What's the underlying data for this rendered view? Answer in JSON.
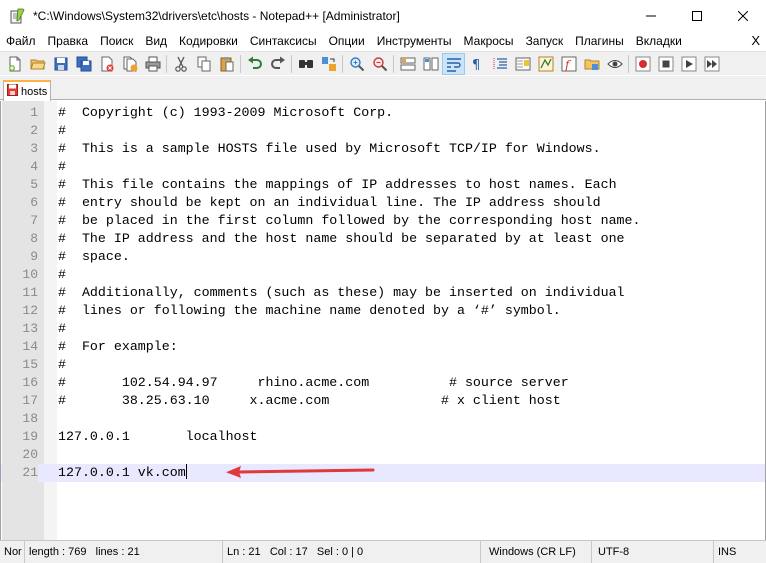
{
  "window": {
    "title": "*C:\\Windows\\System32\\drivers\\etc\\hosts - Notepad++ [Administrator]"
  },
  "menu": {
    "items": [
      "Файл",
      "Правка",
      "Поиск",
      "Вид",
      "Кодировки",
      "Синтаксисы",
      "Опции",
      "Инструменты",
      "Макросы",
      "Запуск",
      "Плагины",
      "Вкладки"
    ],
    "close": "X"
  },
  "toolbar": {
    "icons": [
      "new-file-icon",
      "open-file-icon",
      "save-icon",
      "save-all-icon",
      "close-icon",
      "close-all-icon",
      "print-icon",
      "cut-icon",
      "copy-icon",
      "paste-icon",
      "undo-icon",
      "redo-icon",
      "find-icon",
      "replace-icon",
      "zoom-in-icon",
      "zoom-out-icon",
      "sync-vertical-icon",
      "sync-horizontal-icon",
      "word-wrap-icon",
      "show-all-chars-icon",
      "indent-guide-icon",
      "doc-map-icon",
      "function-list-icon",
      "folder-workspace-icon",
      "monitor-icon",
      "record-macro-icon",
      "stop-macro-icon",
      "play-macro-icon"
    ]
  },
  "tab": {
    "label": "hosts"
  },
  "editor": {
    "lines": [
      {
        "n": "1",
        "text": "#  Copyright (c) 1993-2009 Microsoft Corp."
      },
      {
        "n": "2",
        "text": "#"
      },
      {
        "n": "3",
        "text": "#  This is a sample HOSTS file used by Microsoft TCP/IP for Windows."
      },
      {
        "n": "4",
        "text": "#"
      },
      {
        "n": "5",
        "text": "#  This file contains the mappings of IP addresses to host names. Each"
      },
      {
        "n": "6",
        "text": "#  entry should be kept on an individual line. The IP address should"
      },
      {
        "n": "7",
        "text": "#  be placed in the first column followed by the corresponding host name."
      },
      {
        "n": "8",
        "text": "#  The IP address and the host name should be separated by at least one"
      },
      {
        "n": "9",
        "text": "#  space."
      },
      {
        "n": "10",
        "text": "#"
      },
      {
        "n": "11",
        "text": "#  Additionally, comments (such as these) may be inserted on individual"
      },
      {
        "n": "12",
        "text": "#  lines or following the machine name denoted by a ‘#’ symbol."
      },
      {
        "n": "13",
        "text": "#"
      },
      {
        "n": "14",
        "text": "#  For example:"
      },
      {
        "n": "15",
        "text": "#"
      },
      {
        "n": "16",
        "text": "#       102.54.94.97     rhino.acme.com          # source server"
      },
      {
        "n": "17",
        "text": "#       38.25.63.10     x.acme.com              # x client host"
      },
      {
        "n": "18",
        "text": ""
      },
      {
        "n": "19",
        "text": "127.0.0.1       localhost"
      },
      {
        "n": "20",
        "text": ""
      },
      {
        "n": "21",
        "text": "127.0.0.1 vk.com"
      }
    ],
    "current_line": "21"
  },
  "status": {
    "lang": "Nor",
    "length": "length : 769",
    "lines": "lines : 21",
    "ln": "Ln : 21",
    "col": "Col : 17",
    "sel": "Sel : 0 | 0",
    "eol": "Windows (CR LF)",
    "encoding": "UTF-8",
    "mode": "INS"
  },
  "colors": {
    "current_line_bg": "#e8e8ff",
    "arrow": "#e0393b",
    "tab_accent": "#ffb244"
  }
}
